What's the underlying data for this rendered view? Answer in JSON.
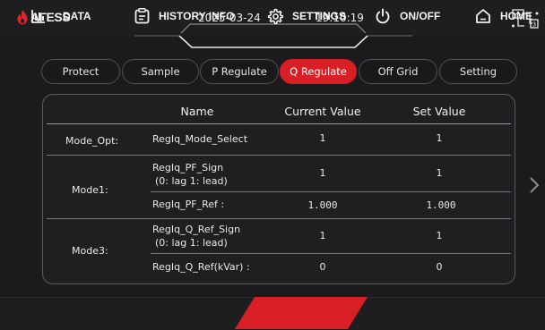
{
  "header": {
    "brand": "AΓESS",
    "date": "2025-03-24",
    "time": "19:10:19"
  },
  "tabs": [
    {
      "label": "Protect",
      "active": false
    },
    {
      "label": "Sample",
      "active": false
    },
    {
      "label": "P Regulate",
      "active": false
    },
    {
      "label": "Q Regulate",
      "active": true
    },
    {
      "label": "Off Grid",
      "active": false
    },
    {
      "label": "Setting",
      "active": false
    }
  ],
  "table": {
    "columns": [
      "Name",
      "Current Value",
      "Set Value"
    ],
    "groups": [
      {
        "label": "Mode_Opt:",
        "rows": [
          {
            "name": [
              "RegIq_Mode_Select"
            ],
            "current": "1",
            "set": "1"
          }
        ]
      },
      {
        "label": "Mode1:",
        "rows": [
          {
            "name": [
              "RegIq_PF_Sign",
              "(0: lag 1: lead)"
            ],
            "current": "1",
            "set": "1"
          },
          {
            "name": [
              "RegIq_PF_Ref :"
            ],
            "current": "1.000",
            "set": "1.000"
          }
        ]
      },
      {
        "label": "Mode3:",
        "rows": [
          {
            "name": [
              "RegIq_Q_Ref_Sign",
              "(0: lag 1: lead)"
            ],
            "current": "1",
            "set": "1"
          },
          {
            "name": [
              "RegIq_Q_Ref(kVar) :"
            ],
            "current": "0",
            "set": "0"
          }
        ]
      }
    ]
  },
  "nav": [
    {
      "label": "DATA",
      "icon": "bar-chart-icon",
      "active": false
    },
    {
      "label": "HISTORY INFO",
      "icon": "clipboard-icon",
      "active": false
    },
    {
      "label": "SETTINGS",
      "icon": "gear-icon",
      "active": true
    },
    {
      "label": "ON/OFF",
      "icon": "power-icon",
      "active": false
    },
    {
      "label": "HOME",
      "icon": "home-icon",
      "active": false
    }
  ],
  "colors": {
    "accent": "#d91f26",
    "background": "#1b1b1d",
    "panel_border": "#5a5a60",
    "text": "#e9e9e9"
  }
}
